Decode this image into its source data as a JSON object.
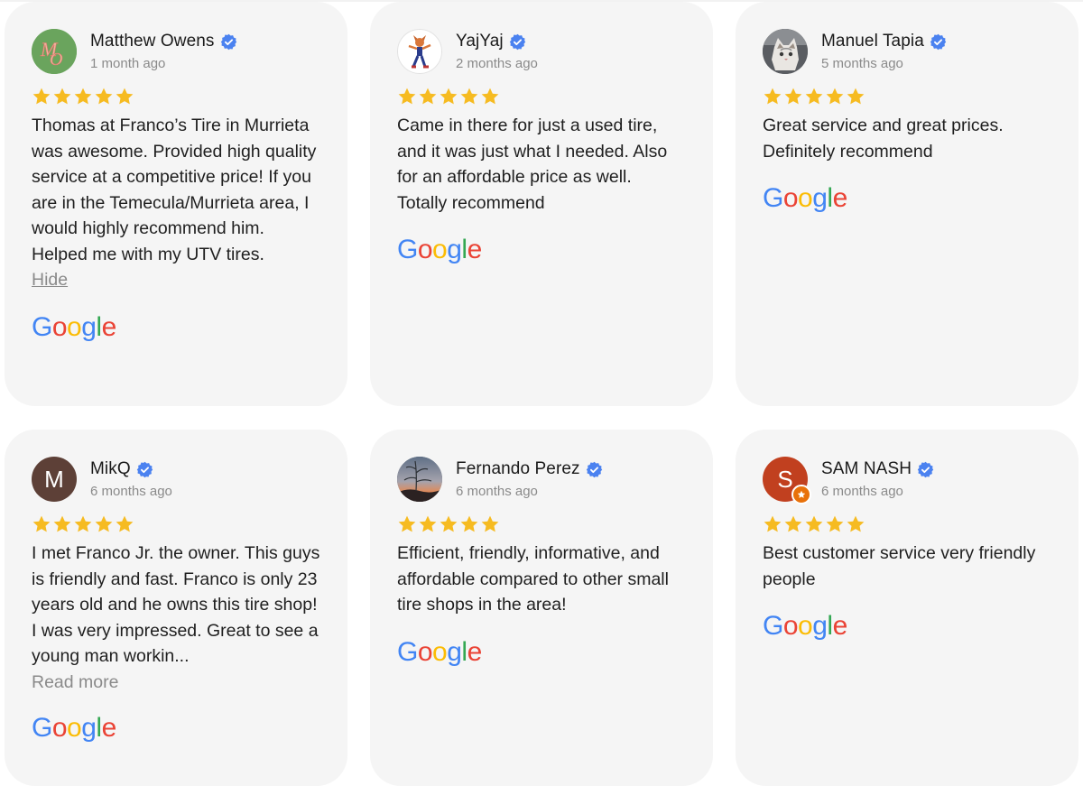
{
  "brand_colors": {
    "google_blue": "#4285F4",
    "google_red": "#EA4335",
    "google_yellow": "#FBBC05",
    "google_green": "#34A853",
    "star": "#F6BB21",
    "verified": "#4B82F0"
  },
  "reviews": [
    {
      "name": "Matthew Owens",
      "time": "1 month ago",
      "rating": 5,
      "text": "Thomas at Franco’s Tire in Murrieta was awesome. Provided high quality service at a competitive price! If you are in the Temecula/Murrieta area, I would highly recommend him. Helped me with my UTV tires.",
      "link": "Hide",
      "avatar": "monogram-mo-avatar",
      "source": "google-logo"
    },
    {
      "name": "YajYaj",
      "time": "2 months ago",
      "rating": 5,
      "text": "Came in there for just a used tire, and it was just what I needed. Also for an affordable price as well. Totally recommend",
      "avatar": "cartoon-character-avatar",
      "source": "google-logo"
    },
    {
      "name": "Manuel Tapia",
      "time": "5 months ago",
      "rating": 5,
      "text": "Great service and great prices. Definitely recommend",
      "avatar": "cat-photo-avatar",
      "source": "google-logo"
    },
    {
      "name": "MikQ",
      "time": "6 months ago",
      "rating": 5,
      "text": "I met Franco Jr. the owner. This guys is friendly and fast. Franco is only 23 years old and he owns this tire shop! I was very impressed. Great to see a young man workin...",
      "link": "Read more",
      "avatar_initial": "M",
      "avatar": "initial-avatar",
      "source": "google-logo"
    },
    {
      "name": "Fernando Perez",
      "time": "6 months ago",
      "rating": 5,
      "text": "Efficient, friendly, informative, and affordable compared to other small tire shops in the area!",
      "avatar": "sunset-photo-avatar",
      "source": "google-logo"
    },
    {
      "name": "SAM NASH",
      "time": "6 months ago",
      "rating": 5,
      "text": "Best customer service very friendly people",
      "avatar_initial": "S",
      "avatar": "initial-avatar",
      "source": "google-logo"
    }
  ]
}
